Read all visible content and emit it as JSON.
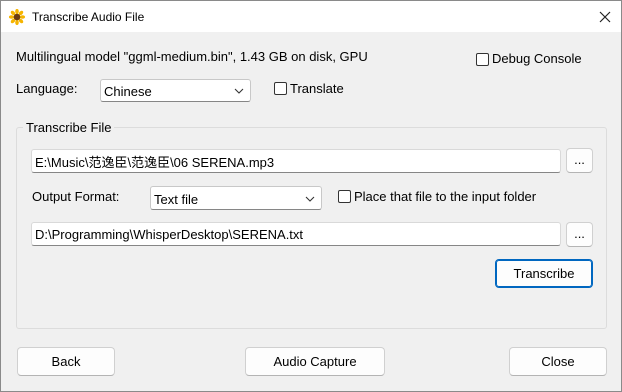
{
  "window": {
    "title": "Transcribe Audio File",
    "app_icon": "sunflower-icon",
    "close_icon": "close-icon"
  },
  "model_info": "Multilingual model \"ggml-medium.bin\", 1.43 GB on disk, GPU",
  "debug_console": {
    "label": "Debug Console",
    "checked": false
  },
  "language": {
    "label": "Language:",
    "selected": "Chinese"
  },
  "translate": {
    "label": "Translate",
    "checked": false
  },
  "transcribe_file": {
    "group_label": "Transcribe File",
    "input_path": "E:\\Music\\范逸臣\\范逸臣\\06 SERENA.mp3",
    "browse_label": "...",
    "output_format_label": "Output Format:",
    "output_format": "Text file",
    "place_in_input_folder": {
      "label": "Place that file to the input folder",
      "checked": false
    },
    "output_path": "D:\\Programming\\WhisperDesktop\\SERENA.txt",
    "browse_output_label": "...",
    "transcribe_label": "Transcribe"
  },
  "footer": {
    "back_label": "Back",
    "audio_capture_label": "Audio Capture",
    "close_label": "Close"
  },
  "colors": {
    "accent": "#0067c0",
    "background": "#f0f0f0"
  }
}
